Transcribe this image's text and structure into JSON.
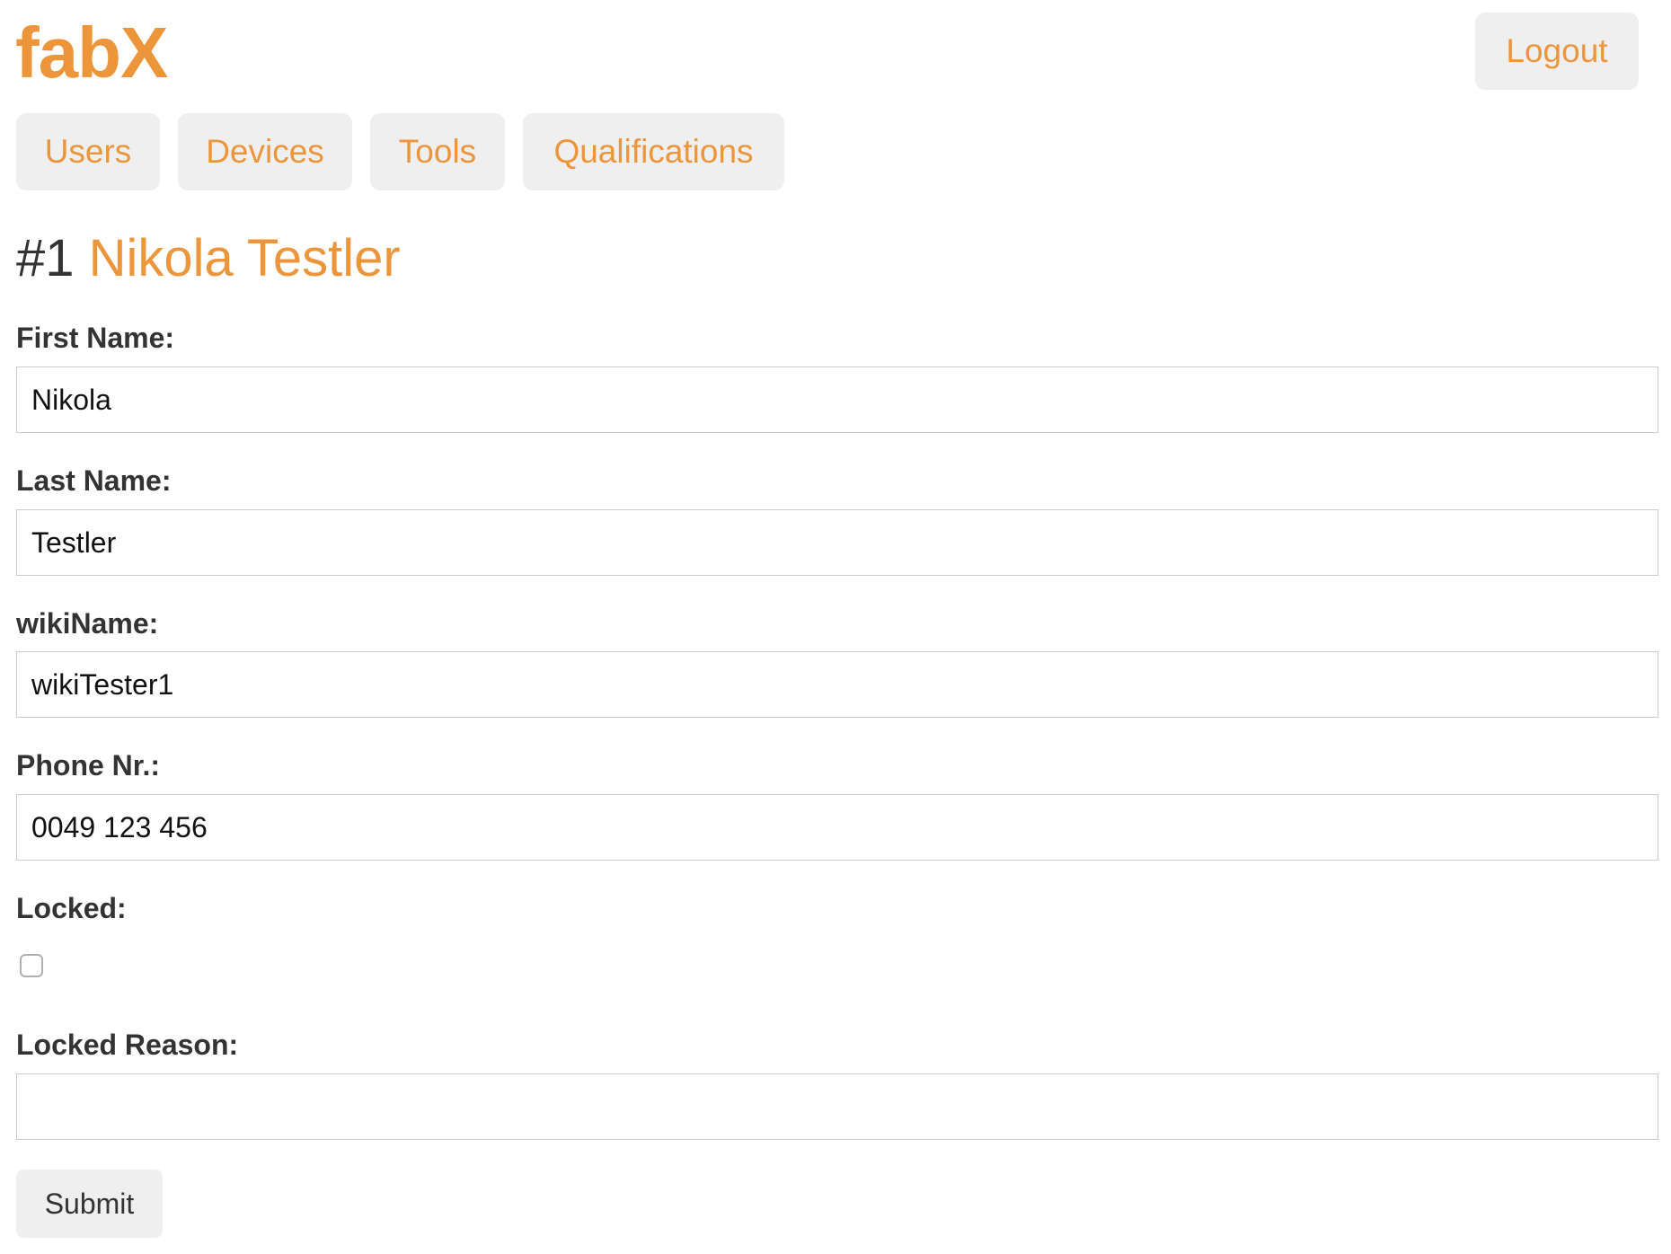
{
  "header": {
    "logo": "fabX",
    "logout_label": "Logout"
  },
  "nav": {
    "users": "Users",
    "devices": "Devices",
    "tools": "Tools",
    "qualifications": "Qualifications"
  },
  "page": {
    "id": "#1",
    "name": "Nikola Testler"
  },
  "form": {
    "first_name": {
      "label": "First Name:",
      "value": "Nikola"
    },
    "last_name": {
      "label": "Last Name:",
      "value": "Testler"
    },
    "wiki_name": {
      "label": "wikiName:",
      "value": "wikiTester1"
    },
    "phone": {
      "label": "Phone Nr.:",
      "value": "0049 123 456"
    },
    "locked": {
      "label": "Locked:",
      "checked": false
    },
    "locked_reason": {
      "label": "Locked Reason:",
      "value": ""
    },
    "submit_label": "Submit"
  },
  "colors": {
    "accent": "#ec953a",
    "button_bg": "#efefef",
    "text": "#333333"
  }
}
